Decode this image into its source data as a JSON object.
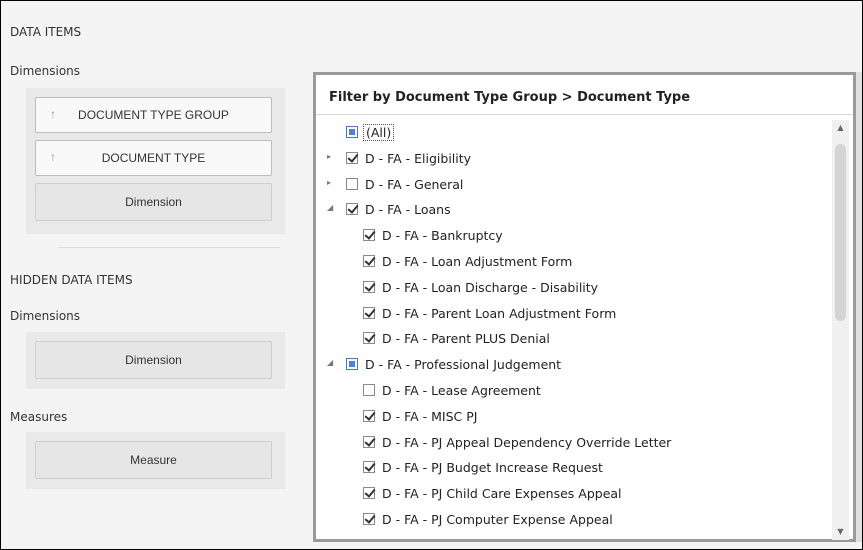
{
  "left_panel": {
    "data_items_title": "DATA ITEMS",
    "dimensions_title": "Dimensions",
    "dimension_buttons": [
      {
        "label": "DOCUMENT TYPE GROUP",
        "arrow": "↑"
      },
      {
        "label": "DOCUMENT TYPE",
        "arrow": "↑"
      }
    ],
    "dimension_placeholder": "Dimension",
    "hidden_title": "HIDDEN DATA ITEMS",
    "hidden_dimensions_title": "Dimensions",
    "hidden_dimension_placeholder": "Dimension",
    "measures_title": "Measures",
    "measure_placeholder": "Measure"
  },
  "filter_dialog": {
    "title": "Filter by Document Type Group > Document Type",
    "tree": [
      {
        "label": "(All)",
        "state": "partial",
        "level": 0,
        "expander": "none"
      },
      {
        "label": "D - FA - Eligibility",
        "state": "checked",
        "level": 0,
        "expander": "collapsed"
      },
      {
        "label": "D - FA - General",
        "state": "unchecked",
        "level": 0,
        "expander": "collapsed"
      },
      {
        "label": "D - FA - Loans",
        "state": "checked",
        "level": 0,
        "expander": "expanded"
      },
      {
        "label": "D - FA - Bankruptcy",
        "state": "checked",
        "level": 1,
        "expander": "none"
      },
      {
        "label": "D - FA - Loan Adjustment Form",
        "state": "checked",
        "level": 1,
        "expander": "none"
      },
      {
        "label": "D - FA - Loan Discharge - Disability",
        "state": "checked",
        "level": 1,
        "expander": "none"
      },
      {
        "label": "D - FA - Parent Loan Adjustment Form",
        "state": "checked",
        "level": 1,
        "expander": "none"
      },
      {
        "label": "D - FA - Parent PLUS Denial",
        "state": "checked",
        "level": 1,
        "expander": "none"
      },
      {
        "label": "D - FA - Professional Judgement",
        "state": "partial",
        "level": 0,
        "expander": "expanded"
      },
      {
        "label": "D - FA - Lease Agreement",
        "state": "unchecked",
        "level": 1,
        "expander": "none"
      },
      {
        "label": "D - FA - MISC PJ",
        "state": "checked",
        "level": 1,
        "expander": "none"
      },
      {
        "label": "D - FA - PJ Appeal Dependency Override Letter",
        "state": "checked",
        "level": 1,
        "expander": "none"
      },
      {
        "label": "D - FA - PJ Budget Increase Request",
        "state": "checked",
        "level": 1,
        "expander": "none"
      },
      {
        "label": "D - FA - PJ Child Care Expenses Appeal",
        "state": "checked",
        "level": 1,
        "expander": "none"
      },
      {
        "label": "D - FA - PJ Computer Expense Appeal",
        "state": "checked",
        "level": 1,
        "expander": "none"
      }
    ],
    "scroll_up_icon": "▲",
    "scroll_down_icon": "▼"
  }
}
